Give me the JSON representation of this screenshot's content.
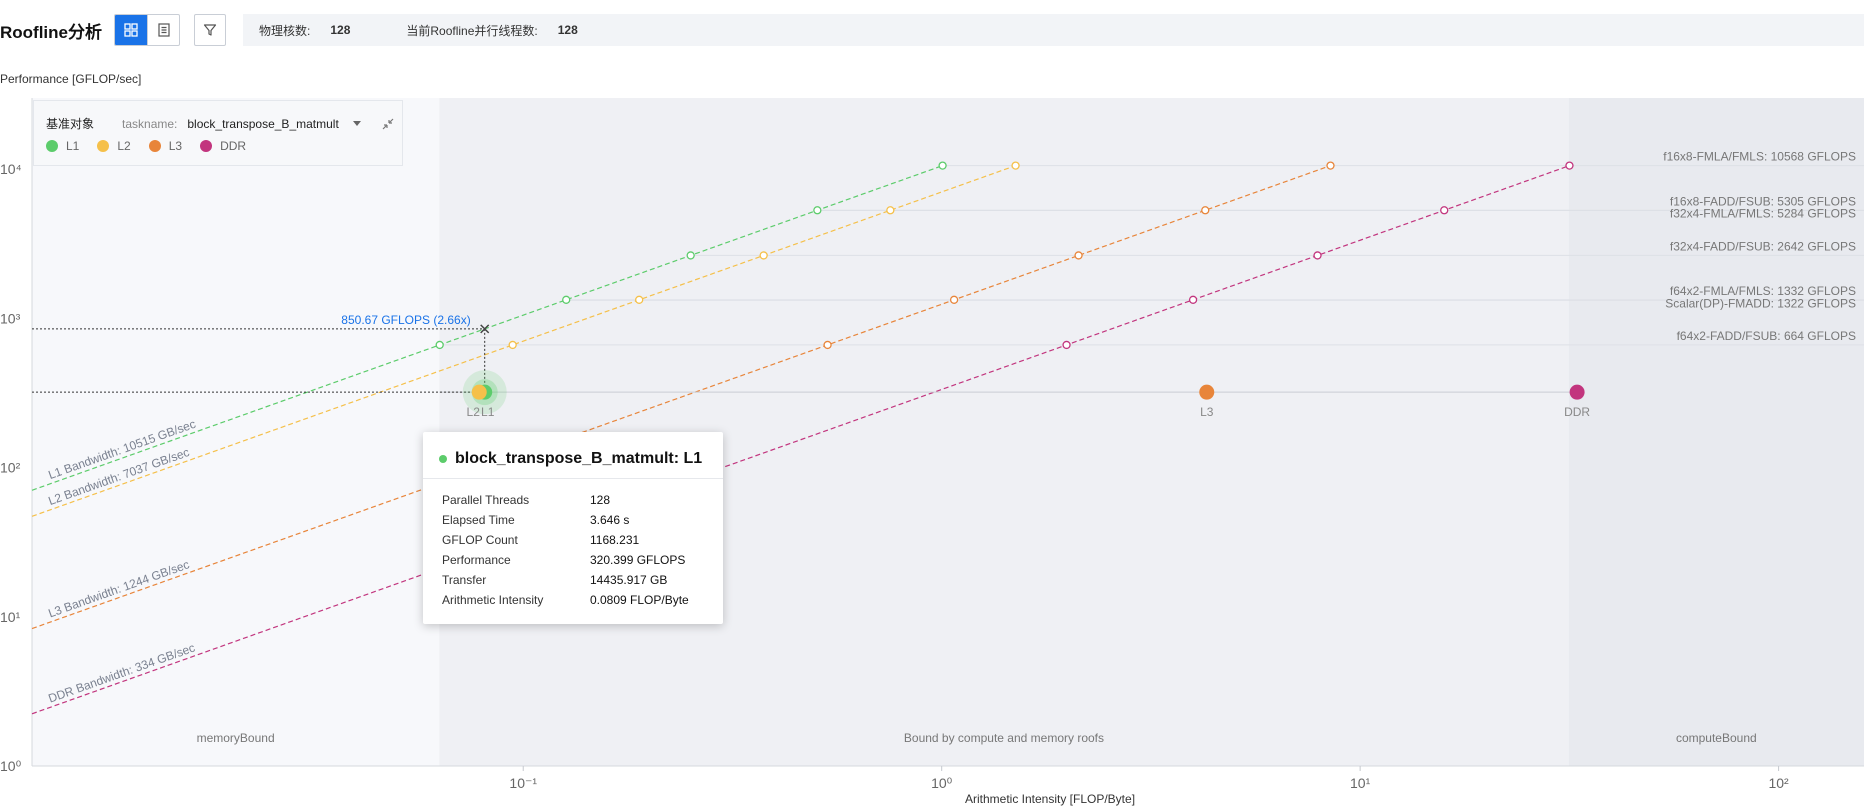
{
  "header": {
    "title": "Roofline分析",
    "physical_cores_label": "物理核数:",
    "physical_cores_value": "128",
    "threads_label": "当前Roofline并行线程数:",
    "threads_value": "128"
  },
  "perf_axis_label": "Performance [GFLOP/sec]",
  "legend": {
    "base_label": "基准对象",
    "task_label": "taskname:",
    "task_value": "block_transpose_B_matmult",
    "items": [
      {
        "name": "L1",
        "color": "#5ccc6b"
      },
      {
        "name": "L2",
        "color": "#f5c04a"
      },
      {
        "name": "L3",
        "color": "#e8853a"
      },
      {
        "name": "DDR",
        "color": "#c2357e"
      }
    ]
  },
  "tooltip": {
    "title": "block_transpose_B_matmult: L1",
    "rows": [
      {
        "key": "Parallel Threads",
        "value": "128"
      },
      {
        "key": "Elapsed Time",
        "value": "3.646 s"
      },
      {
        "key": "GFLOP Count",
        "value": "1168.231"
      },
      {
        "key": "Performance",
        "value": "320.399 GFLOPS"
      },
      {
        "key": "Transfer",
        "value": "14435.917 GB"
      },
      {
        "key": "Arithmetic Intensity",
        "value": "0.0809 FLOP/Byte"
      }
    ]
  },
  "chart_data": {
    "type": "scatter",
    "scale": "log-log",
    "xlabel": "Arithmetic Intensity [FLOP/Byte]",
    "ylabel": "Performance [GFLOP/sec]",
    "xlim": [
      0.0067,
      160
    ],
    "ylim": [
      1,
      30000
    ],
    "x_ticks": [
      {
        "value": 0.1,
        "label": "10⁻¹"
      },
      {
        "value": 1,
        "label": "10⁰"
      },
      {
        "value": 10,
        "label": "10¹"
      },
      {
        "value": 100,
        "label": "10²"
      }
    ],
    "y_ticks": [
      {
        "value": 1,
        "label": "10⁰"
      },
      {
        "value": 10,
        "label": "10¹"
      },
      {
        "value": 100,
        "label": "10²"
      },
      {
        "value": 1000,
        "label": "10³"
      },
      {
        "value": 10000,
        "label": "10⁴"
      }
    ],
    "bandwidths": [
      {
        "name": "L1",
        "label": "L1 Bandwidth: 10515 GB/sec",
        "value": 10515,
        "color": "#5ccc6b"
      },
      {
        "name": "L2",
        "label": "L2 Bandwidth: 7037 GB/sec",
        "value": 7037,
        "color": "#f5c04a"
      },
      {
        "name": "L3",
        "label": "L3 Bandwidth: 1244 GB/sec",
        "value": 1244,
        "color": "#e8853a"
      },
      {
        "name": "DDR",
        "label": "DDR Bandwidth: 334 GB/sec",
        "value": 334,
        "color": "#c2357e"
      }
    ],
    "compute_roofs": [
      {
        "label": "f16x8-FMLA/FMLS: 10568 GFLOPS",
        "value": 10568
      },
      {
        "label": "f16x8-FADD/FSUB: 5305 GFLOPS",
        "value": 5305
      },
      {
        "label": "f32x4-FMLA/FMLS: 5284 GFLOPS",
        "value": 5284
      },
      {
        "label": "f32x4-FADD/FSUB: 2642 GFLOPS",
        "value": 2642
      },
      {
        "label": "f64x2-FMLA/FMLS: 1332 GFLOPS",
        "value": 1332
      },
      {
        "label": "Scalar(DP)-FMADD: 1322 GFLOPS",
        "value": 1322
      },
      {
        "label": "f64x2-FADD/FSUB: 664 GFLOPS",
        "value": 664
      }
    ],
    "points": [
      {
        "name": "L1",
        "label": "L1",
        "x": 0.0809,
        "y": 320.399,
        "color": "#5ccc6b"
      },
      {
        "name": "L2",
        "label": "L2",
        "x": 0.0785,
        "y": 320.399,
        "color": "#f5c04a"
      },
      {
        "name": "L3",
        "label": "L3",
        "x": 4.3,
        "y": 320.399,
        "color": "#e8853a"
      },
      {
        "name": "DDR",
        "label": "DDR",
        "x": 33,
        "y": 320.399,
        "color": "#c2357e"
      }
    ],
    "ceiling_marker": {
      "x": 0.0809,
      "y": 850.67,
      "label": "850.67 GFLOPS (2.66x)"
    },
    "regions": [
      {
        "label": "memoryBound",
        "x_from": 0.0067,
        "x_to": 0.063
      },
      {
        "label": "Bound by compute and memory roofs",
        "x_from": 0.063,
        "x_to": 31.5
      },
      {
        "label": "computeBound",
        "x_from": 31.5,
        "x_to": 160
      }
    ]
  }
}
